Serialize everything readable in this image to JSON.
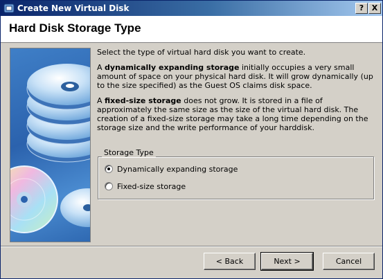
{
  "window": {
    "title": "Create New Virtual Disk",
    "help_label": "?",
    "close_label": "X"
  },
  "header": {
    "title": "Hard Disk Storage Type"
  },
  "body": {
    "intro": "Select the type of virtual hard disk you want to create.",
    "dynamic_prefix": "A ",
    "dynamic_bold": "dynamically expanding storage",
    "dynamic_rest": " initially occupies a very small amount of space on your physical hard disk. It will grow dynamically (up to the size specified) as the Guest OS claims disk space.",
    "fixed_prefix": "A ",
    "fixed_bold": "fixed-size storage",
    "fixed_rest": " does not grow. It is stored in a file of approximately the same size as the size of the virtual hard disk. The creation of a fixed-size storage may take a long time depending on the storage size and the write performance of your harddisk."
  },
  "storage_type": {
    "legend": "Storage Type",
    "options": [
      {
        "label": "Dynamically expanding storage",
        "checked": true
      },
      {
        "label": "Fixed-size storage",
        "checked": false
      }
    ]
  },
  "buttons": {
    "back": "< Back",
    "next": "Next >",
    "cancel": "Cancel"
  },
  "icons": {
    "app": "virtualbox-icon",
    "banner": "disk-stack-illustration"
  },
  "colors": {
    "titlebar_start": "#0a246a",
    "titlebar_end": "#a6caf0",
    "dialog_bg": "#d4d0c8",
    "banner_blue": "#2b62ad"
  }
}
